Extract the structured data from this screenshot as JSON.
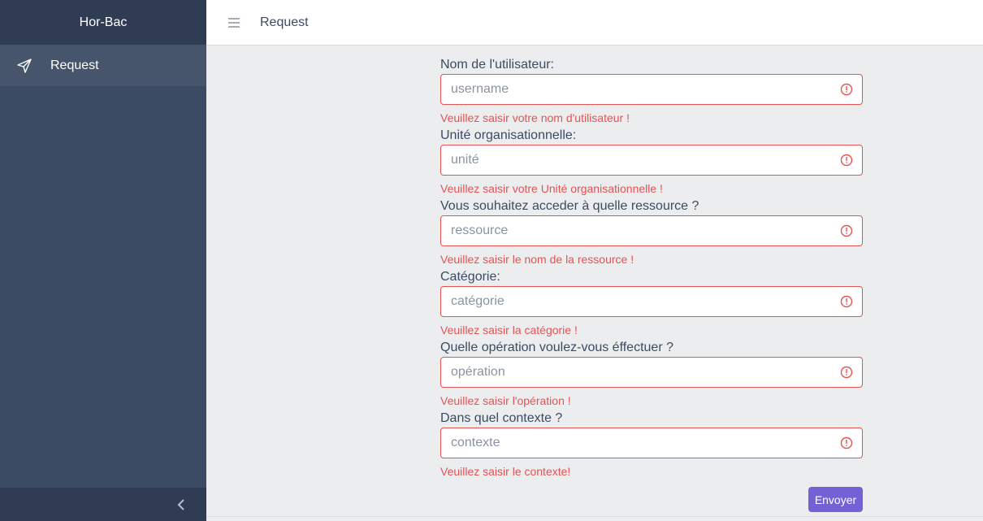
{
  "app": {
    "brand": "Hor-Bac"
  },
  "sidebar": {
    "items": [
      {
        "label": "Request",
        "icon": "send-icon"
      }
    ],
    "toggler_icon": "chevron-left-icon"
  },
  "header": {
    "title": "Request",
    "menu_icon": "hamburger-icon"
  },
  "form": {
    "fields": [
      {
        "label": "Nom de l'utilisateur:",
        "placeholder": "username",
        "value": "",
        "error": "Veuillez saisir votre nom d'utilisateur !"
      },
      {
        "label": "Unité organisationnelle:",
        "placeholder": "unité",
        "value": "",
        "error": "Veuillez saisir votre Unité organisationnelle !"
      },
      {
        "label": "Vous souhaitez acceder à quelle ressource ?",
        "placeholder": "ressource",
        "value": "",
        "error": "Veuillez saisir le nom de la ressource !"
      },
      {
        "label": "Catégorie:",
        "placeholder": "catégorie",
        "value": "",
        "error": "Veuillez saisir la catégorie !"
      },
      {
        "label": "Quelle opération voulez-vous éffectuer ?",
        "placeholder": "opération",
        "value": "",
        "error": "Veuillez saisir l'opération !"
      },
      {
        "label": "Dans quel contexte ?",
        "placeholder": "contexte",
        "value": "",
        "error": "Veuillez saisir le contexte!"
      }
    ],
    "submit_label": "Envoyer"
  },
  "colors": {
    "sidebar_bg": "#3c4b64",
    "brand_bg": "#303c54",
    "error": "#e55353",
    "primary_button": "#7561d6",
    "page_bg": "#ebedef"
  }
}
